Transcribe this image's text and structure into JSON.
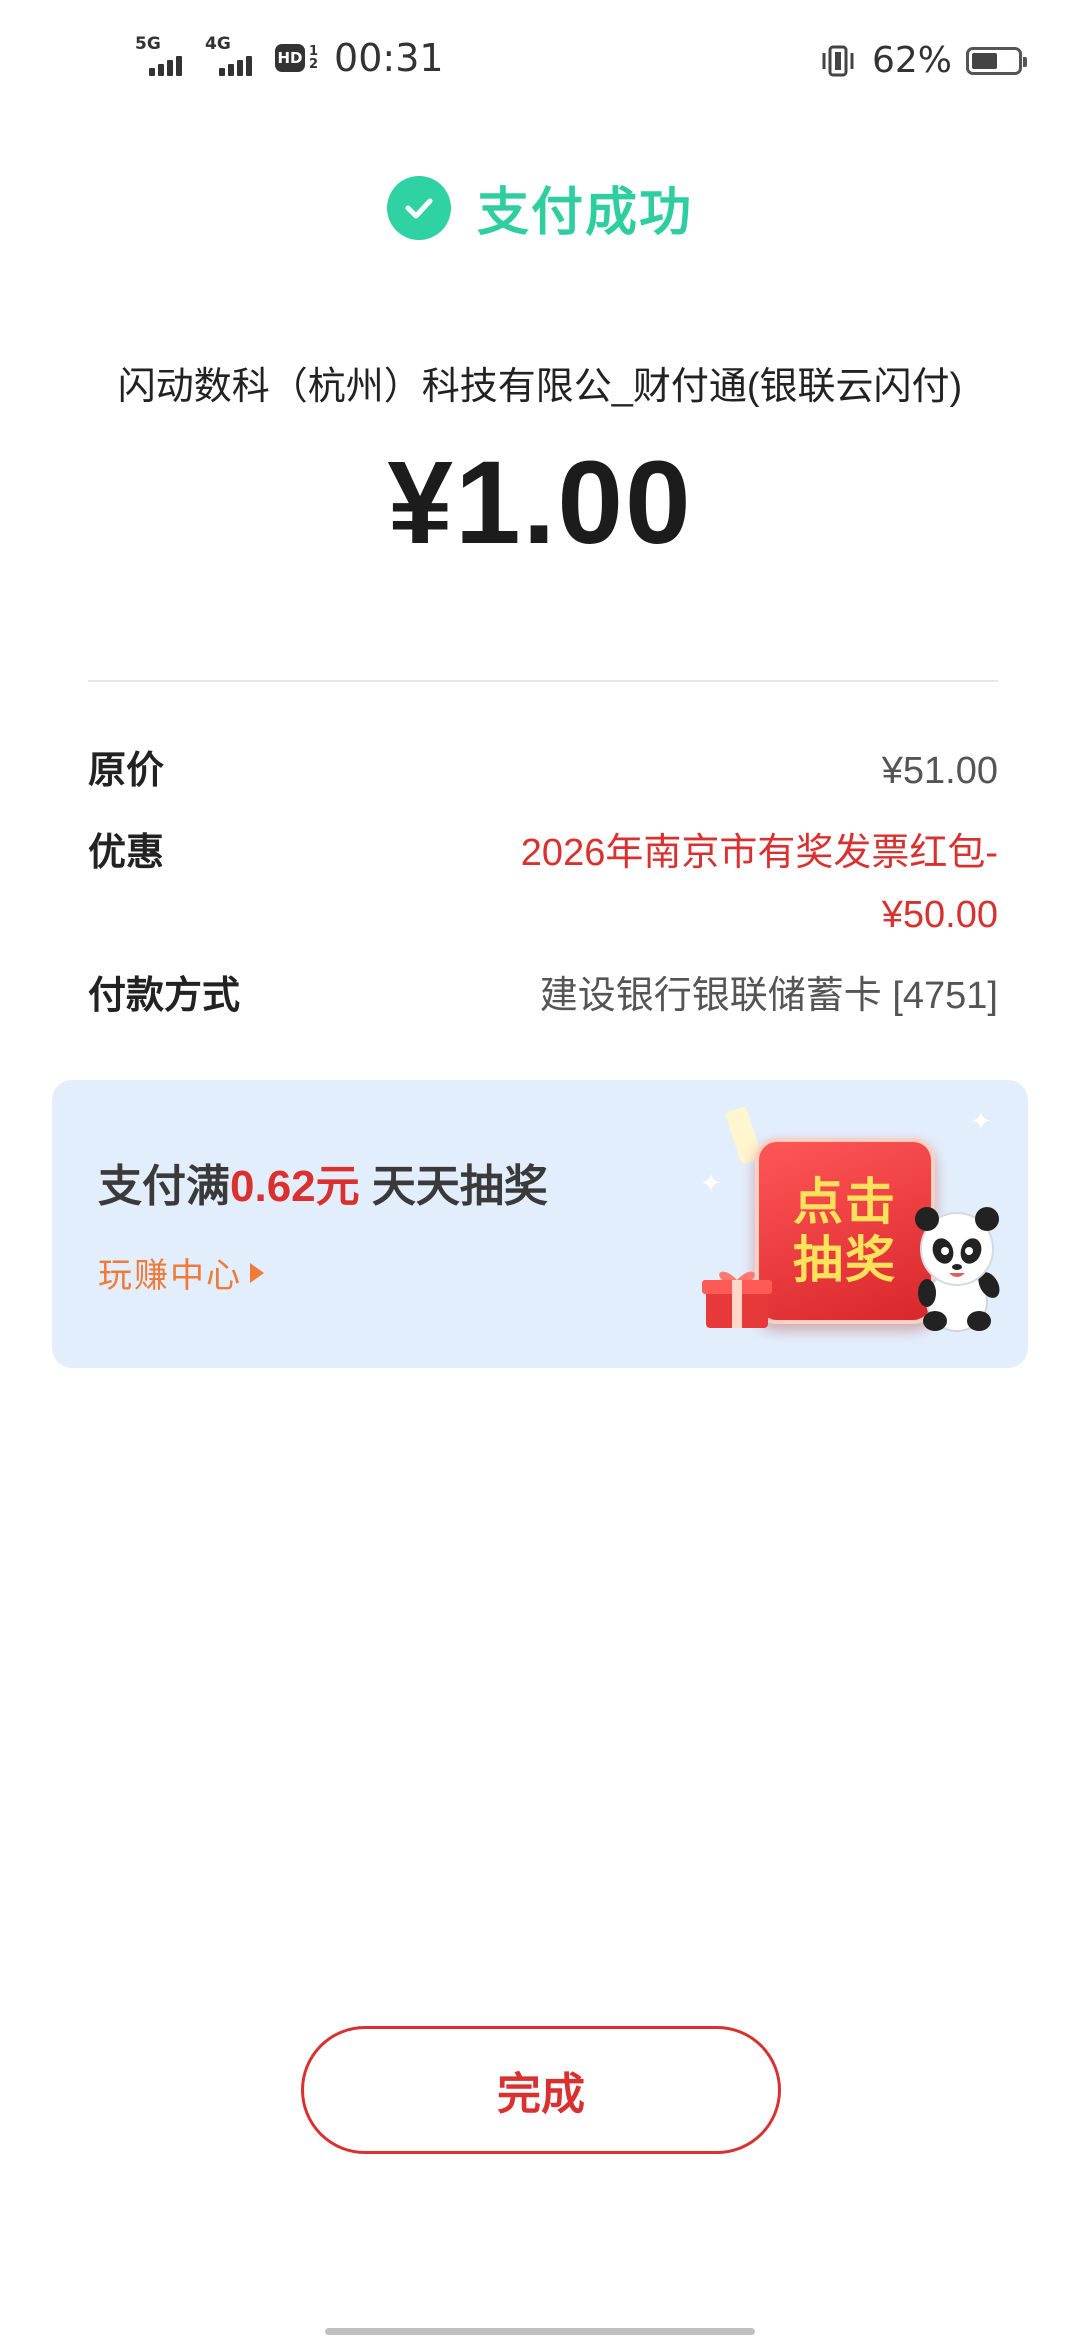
{
  "status_bar": {
    "sim1_type": "5G",
    "sim2_type": "4G",
    "hd_label": "HD",
    "hd_top": "1",
    "hd_bottom": "2",
    "time": "00:31",
    "battery": "62%",
    "battery_level": 0.62
  },
  "header": {
    "title": "支付成功",
    "icon": "check-circle-icon",
    "color": "#2fcea0"
  },
  "payment": {
    "merchant": "闪动数科（杭州）科技有限公_财付通(银联云闪付)",
    "amount": "¥1.00"
  },
  "details": {
    "original_label": "原价",
    "original_value": "¥51.00",
    "discount_label": "优惠",
    "discount_value": "2026年南京市有奖发票红包-¥50.00",
    "method_label": "付款方式",
    "method_value": "建设银行银联储蓄卡 [4751]"
  },
  "promo": {
    "title_prefix": "支付满",
    "title_amount": "0.62元",
    "title_suffix": " 天天抽奖",
    "link": "玩赚中心",
    "lottery_line1": "点击",
    "lottery_line2": "抽奖",
    "background": "#e3eefc",
    "accent": "#d8312f",
    "link_color": "#f07a3a"
  },
  "actions": {
    "done_label": "完成"
  }
}
